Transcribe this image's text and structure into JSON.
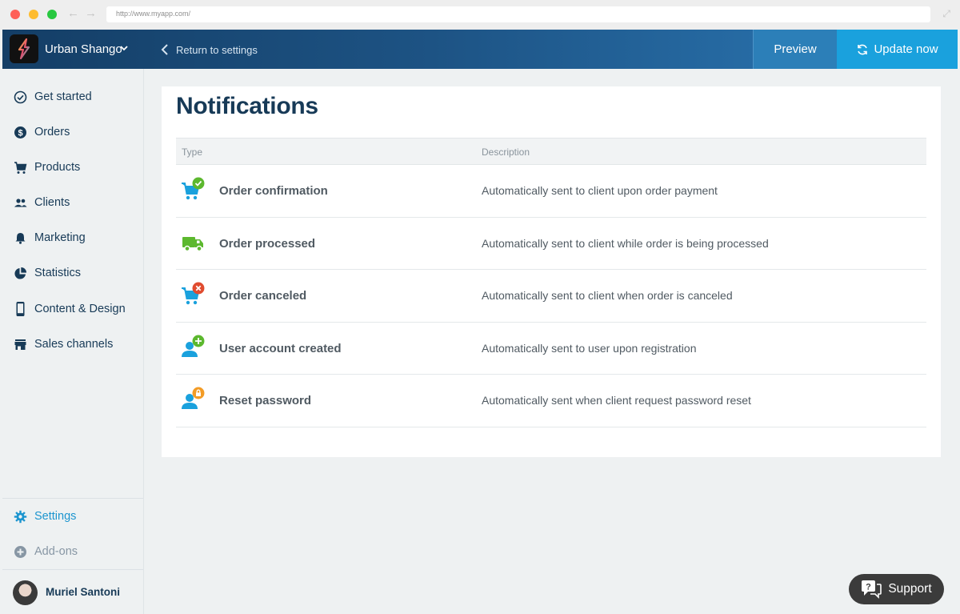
{
  "browser": {
    "url": "http://www.myapp.com/"
  },
  "header": {
    "store_name": "Urban Shango",
    "return_label": "Return to settings",
    "preview_label": "Preview",
    "update_label": "Update now"
  },
  "sidebar": {
    "items": [
      {
        "label": "Get started",
        "icon": "check-circle-icon"
      },
      {
        "label": "Orders",
        "icon": "dollar-circle-icon"
      },
      {
        "label": "Products",
        "icon": "cart-icon"
      },
      {
        "label": "Clients",
        "icon": "people-icon"
      },
      {
        "label": "Marketing",
        "icon": "bell-icon"
      },
      {
        "label": "Statistics",
        "icon": "pie-chart-icon"
      },
      {
        "label": "Content & Design",
        "icon": "phone-icon"
      },
      {
        "label": "Sales channels",
        "icon": "store-icon"
      }
    ],
    "settings_label": "Settings",
    "addons_label": "Add-ons",
    "user_name": "Muriel Santoni"
  },
  "main": {
    "title": "Notifications",
    "columns": {
      "type": "Type",
      "description": "Description"
    },
    "rows": [
      {
        "type": "Order confirmation",
        "description": "Automatically sent to client upon order payment",
        "icon": "cart-check-icon"
      },
      {
        "type": "Order processed",
        "description": "Automatically sent to client while order is being processed",
        "icon": "truck-icon"
      },
      {
        "type": "Order canceled",
        "description": "Automatically sent to client when order is canceled",
        "icon": "cart-cancel-icon"
      },
      {
        "type": "User account created",
        "description": "Automatically sent to user upon registration",
        "icon": "user-add-icon"
      },
      {
        "type": "Reset password",
        "description": "Automatically sent when client request password reset",
        "icon": "user-lock-icon"
      }
    ]
  },
  "support": {
    "label": "Support"
  },
  "colors": {
    "accent": "#1aa1dd",
    "navy": "#173a57",
    "success": "#5cb82e",
    "danger": "#e04b2f",
    "warning": "#f39c26"
  }
}
